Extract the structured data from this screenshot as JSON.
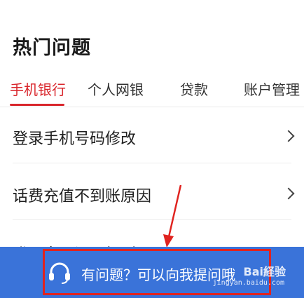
{
  "page": {
    "title": "热门问题"
  },
  "tabs": [
    {
      "label": "手机银行",
      "active": true
    },
    {
      "label": "个人网银",
      "active": false
    },
    {
      "label": "贷款",
      "active": false
    },
    {
      "label": "账户管理",
      "active": false
    }
  ],
  "faq": [
    {
      "question": "登录手机号码修改"
    },
    {
      "question": "话费充值不到账原因"
    },
    {
      "question": "登录密码设置规则"
    }
  ],
  "ask_bar": {
    "label": "有问题？可以向我提问哦",
    "icon": "headset-icon"
  },
  "watermark": {
    "brand": "Bai経验",
    "url": "jingyan.baidu.com"
  },
  "colors": {
    "accent": "#d9262c",
    "bar": "#3a73d9",
    "highlight": "#e0231f"
  }
}
